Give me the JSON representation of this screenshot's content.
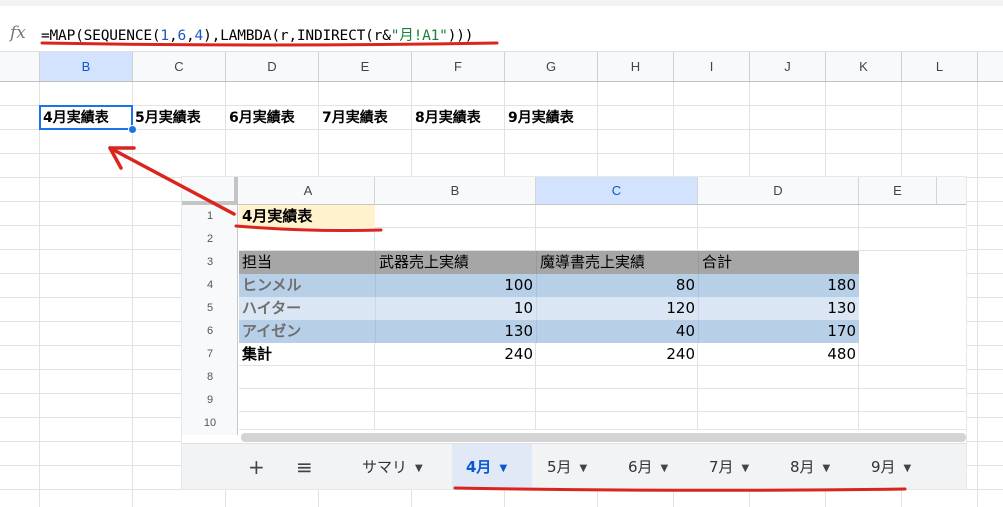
{
  "formula_bar": {
    "fx_label": "fx",
    "formula_parts": [
      {
        "t": "=MAP(SEQUENCE(",
        "k": ""
      },
      {
        "t": "1",
        "k": "num"
      },
      {
        "t": ",",
        "k": ""
      },
      {
        "t": "6",
        "k": "num"
      },
      {
        "t": ",",
        "k": ""
      },
      {
        "t": "4",
        "k": "num"
      },
      {
        "t": "),LAMBDA(r,INDIRECT(r&",
        "k": ""
      },
      {
        "t": "\"月!A1\"",
        "k": "str"
      },
      {
        "t": ")))",
        "k": ""
      }
    ]
  },
  "main_sheet": {
    "columns": [
      "B",
      "C",
      "D",
      "E",
      "F",
      "G",
      "H",
      "I",
      "J",
      "K",
      "L"
    ],
    "selected_column": "B",
    "results": [
      "4月実績表",
      "5月実績表",
      "6月実績表",
      "7月実績表",
      "8月実績表",
      "9月実績表"
    ]
  },
  "embedded_sheet": {
    "columns": [
      "A",
      "B",
      "C",
      "D",
      "E"
    ],
    "selected_column": "C",
    "row_numbers": [
      "1",
      "2",
      "3",
      "4",
      "5",
      "6",
      "7",
      "8",
      "9",
      "10"
    ],
    "title": "4月実績表",
    "table_headers": [
      "担当",
      "武器売上実績",
      "魔導書売上実績",
      "合計"
    ],
    "table_rows": [
      {
        "name": "ヒンメル",
        "a": "100",
        "b": "80",
        "total": "180"
      },
      {
        "name": "ハイター",
        "a": "10",
        "b": "120",
        "total": "130"
      },
      {
        "name": "アイゼン",
        "a": "130",
        "b": "40",
        "total": "170"
      }
    ],
    "totals_row": {
      "name": "集計",
      "a": "240",
      "b": "240",
      "total": "480"
    },
    "tabs": {
      "add_icon": "+",
      "menu_icon": "≡",
      "items": [
        {
          "label": "サマリ",
          "active": false
        },
        {
          "label": "4月",
          "active": true
        },
        {
          "label": "5月",
          "active": false
        },
        {
          "label": "6月",
          "active": false
        },
        {
          "label": "7月",
          "active": false
        },
        {
          "label": "8月",
          "active": false
        },
        {
          "label": "9月",
          "active": false
        }
      ]
    }
  },
  "colors": {
    "annotation_red": "#d9251d",
    "header_row": "#a6a6a6",
    "banded_dark": "#b8cfe8",
    "banded_light": "#dae6f4",
    "title_fill": "#fff2cc",
    "accent_blue": "#1a73e8"
  }
}
